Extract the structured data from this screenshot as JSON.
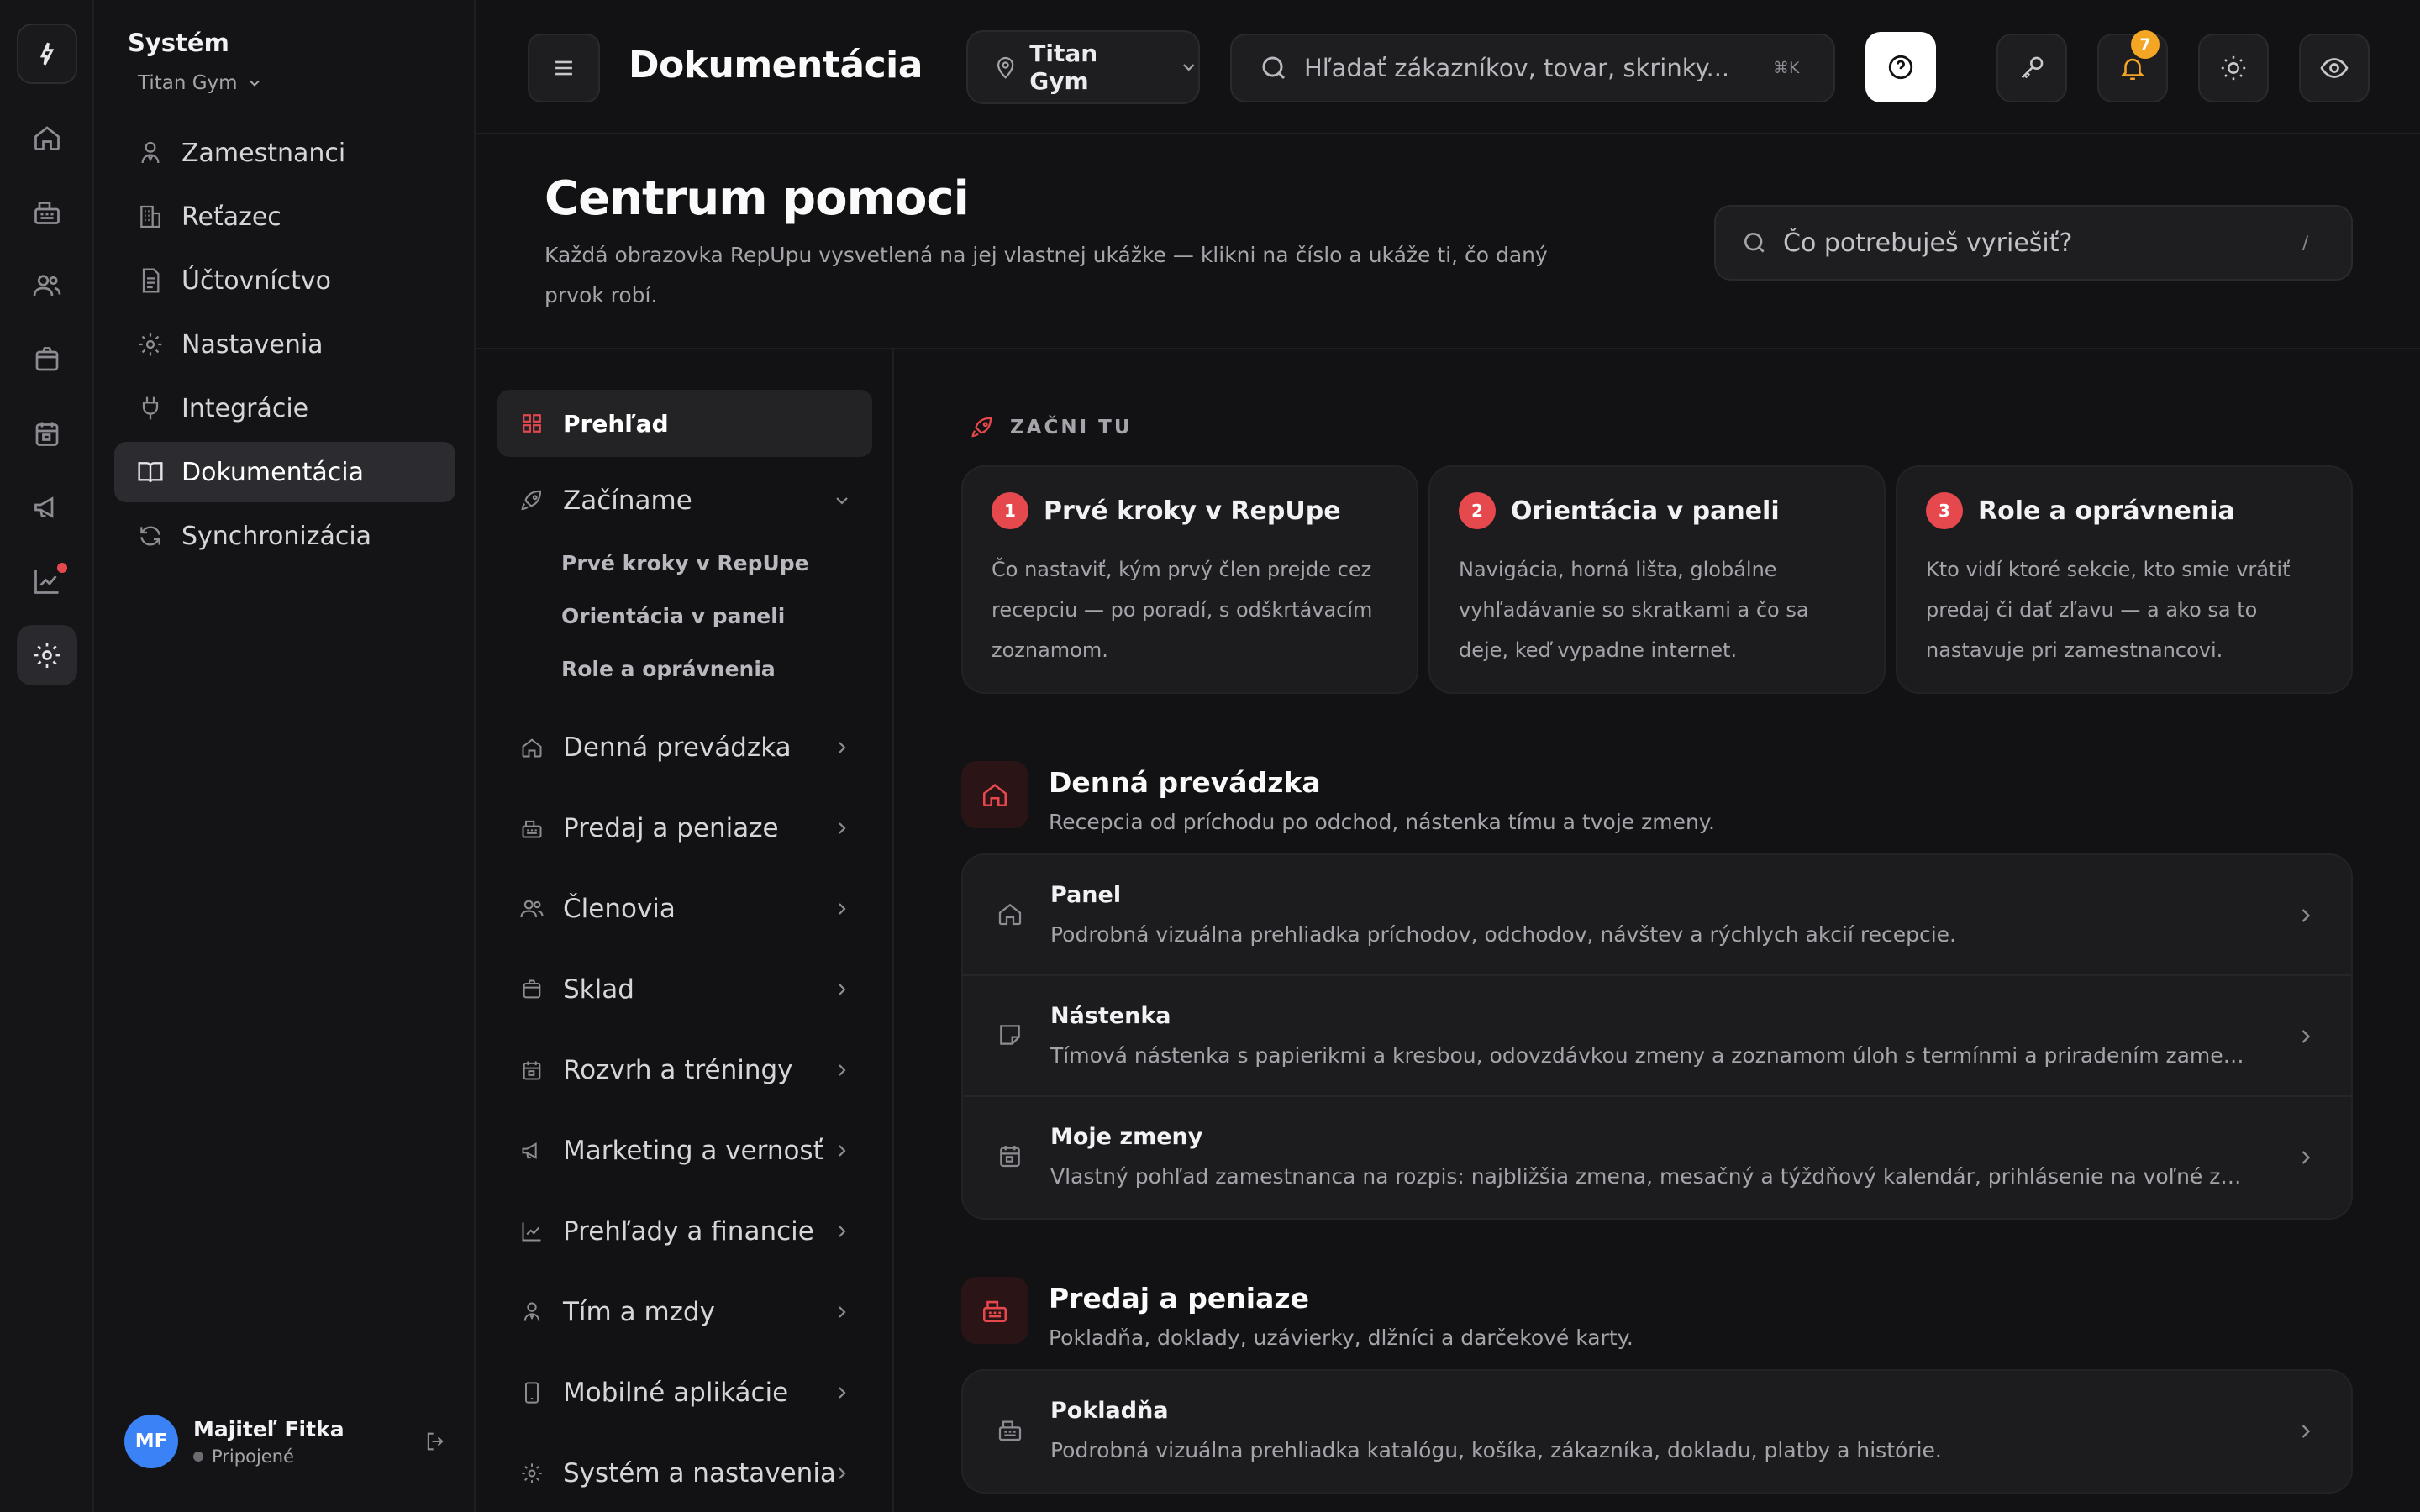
{
  "system": {
    "title": "Systém",
    "gym": "Titan Gym",
    "nav": [
      {
        "label": "Zamestnanci",
        "icon": "staff-icon"
      },
      {
        "label": "Reťazec",
        "icon": "building-icon"
      },
      {
        "label": "Účtovníctvo",
        "icon": "document-icon"
      },
      {
        "label": "Nastavenia",
        "icon": "gear-icon"
      },
      {
        "label": "Integrácie",
        "icon": "plug-icon"
      },
      {
        "label": "Dokumentácia",
        "icon": "book-icon",
        "active": true
      },
      {
        "label": "Synchronizácia",
        "icon": "sync-icon"
      }
    ]
  },
  "user": {
    "initials": "MF",
    "name": "Majiteľ Fitka",
    "status": "Pripojené"
  },
  "topbar": {
    "title": "Dokumentácia",
    "gym_select": "Titan Gym",
    "search_placeholder": "Hľadať zákazníkov, tovar, skrinky...",
    "search_shortcut": "⌘K",
    "notifications_count": "7"
  },
  "header": {
    "title": "Centrum pomoci",
    "description": "Každá obrazovka RepUpu vysvetlená na jej vlastnej ukážke — klikni na číslo a ukáže ti, čo daný prvok robí.",
    "search_placeholder": "Čo potrebuješ vyriešiť?",
    "search_shortcut": "/"
  },
  "docnav": {
    "overview": "Prehľad",
    "getting_started": {
      "label": "Začíname",
      "children": [
        "Prvé kroky v RepUpe",
        "Orientácia v paneli",
        "Role a oprávnenia"
      ]
    },
    "items": [
      "Denná prevádzka",
      "Predaj a peniaze",
      "Členovia",
      "Sklad",
      "Rozvrh a tréningy",
      "Marketing a vernosť",
      "Prehľady a financie",
      "Tím a mzdy",
      "Mobilné aplikácie",
      "Systém a nastavenia"
    ]
  },
  "start": {
    "label": "ZAČNI TU",
    "cards": [
      {
        "num": "1",
        "title": "Prvé kroky v RepUpe",
        "desc": "Čo nastaviť, kým prvý člen prejde cez recepciu — po poradí, s odškrtávacím zoznamom."
      },
      {
        "num": "2",
        "title": "Orientácia v paneli",
        "desc": "Navigácia, horná lišta, globálne vyhľadávanie so skratkami a čo sa deje, keď vypadne internet."
      },
      {
        "num": "3",
        "title": "Role a oprávnenia",
        "desc": "Kto vidí ktoré sekcie, kto smie vrátiť predaj či dať zľavu — a ako sa to nastavuje pri zamestnancovi."
      }
    ]
  },
  "categories": [
    {
      "title": "Denná prevádzka",
      "desc": "Recepcia od príchodu po odchod, nástenka tímu a tvoje zmeny.",
      "rows": [
        {
          "title": "Panel",
          "desc": "Podrobná vizuálna prehliadka príchodov, odchodov, návštev a rýchlych akcií recepcie."
        },
        {
          "title": "Nástenka",
          "desc": "Tímová nástenka s papierikmi a kresbou, odovzdávkou zmeny a zoznamom úloh s termínmi a priradením zamestnancom."
        },
        {
          "title": "Moje zmeny",
          "desc": "Vlastný pohľad zamestnanca na rozpis: najbližšia zmena, mesačný a týždňový kalendár, prihlásenie na voľné zmeny, žiadosť o výmenu a dovolenku."
        }
      ]
    },
    {
      "title": "Predaj a peniaze",
      "desc": "Pokladňa, doklady, uzávierky, dlžníci a darčekové karty.",
      "rows": [
        {
          "title": "Pokladňa",
          "desc": "Podrobná vizuálna prehliadka katalógu, košíka, zákazníka, dokladu, platby a histórie."
        }
      ]
    }
  ]
}
